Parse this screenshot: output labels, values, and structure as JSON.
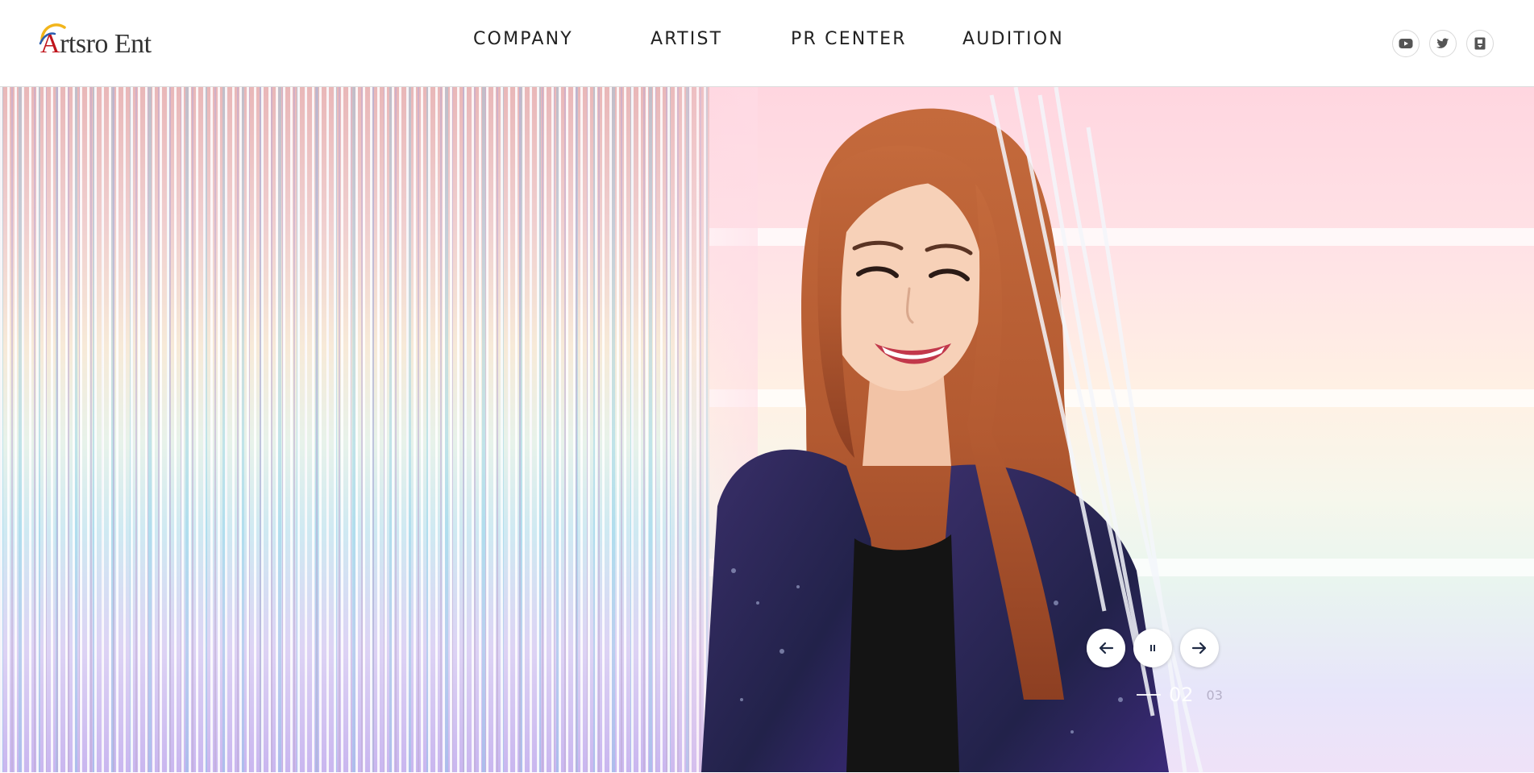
{
  "header": {
    "logo": {
      "text": "Artsro Ent",
      "initial": "A",
      "rest": "rtsro Ent"
    },
    "nav": [
      {
        "label": "COMPANY"
      },
      {
        "label": "ARTIST"
      },
      {
        "label": "PR CENTER"
      },
      {
        "label": "AUDITION"
      }
    ],
    "social": [
      {
        "icon": "youtube-icon"
      },
      {
        "icon": "twitter-icon"
      },
      {
        "icon": "blog-icon"
      }
    ]
  },
  "hero": {
    "image": "artist-photo",
    "controls": {
      "prev_icon": "arrow-left-icon",
      "pause_icon": "pause-icon",
      "next_icon": "arrow-right-icon"
    },
    "counter": {
      "current": "02",
      "next": "03"
    }
  },
  "colors": {
    "nav_text": "#222222",
    "logo_red": "#c0141b",
    "control_icon": "#1f2a44"
  }
}
